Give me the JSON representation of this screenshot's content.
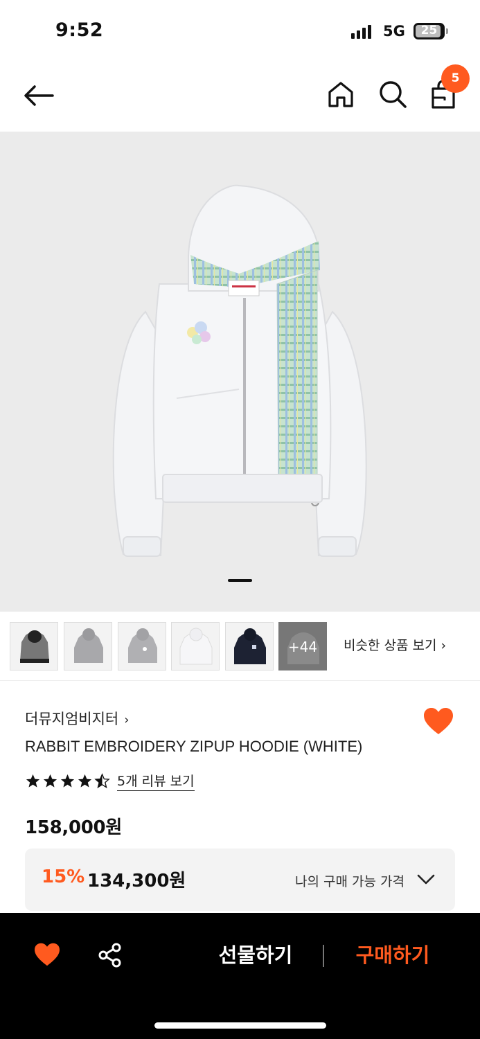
{
  "status_bar": {
    "time": "9:52",
    "network": "5G",
    "battery": "25"
  },
  "header": {
    "cart_count": "5"
  },
  "thumbnails": {
    "more_label": "+44",
    "similar_label": "비슷한 상품 보기",
    "similar_chevron": "›"
  },
  "product": {
    "brand": "더뮤지엄비지터",
    "brand_chevron": "›",
    "name": "RABBIT EMBROIDERY ZIPUP HOODIE (WHITE)",
    "rating": 4.5,
    "review_link": "5개 리뷰 보기",
    "price": "158,000원",
    "discount_rate": "15%",
    "discount_price": "134,300원",
    "my_price_label": "나의 구매 가능 가격"
  },
  "bottom_bar": {
    "gift_label": "선물하기",
    "buy_label": "구매하기"
  },
  "colors": {
    "accent": "#ff5a1f",
    "bottom_bar_bg": "#000000",
    "hero_bg": "#ebebeb"
  },
  "icons": [
    "back-arrow-icon",
    "home-icon",
    "search-icon",
    "shopping-bag-icon",
    "heart-icon",
    "share-icon",
    "chevron-down-icon",
    "star-icon"
  ]
}
